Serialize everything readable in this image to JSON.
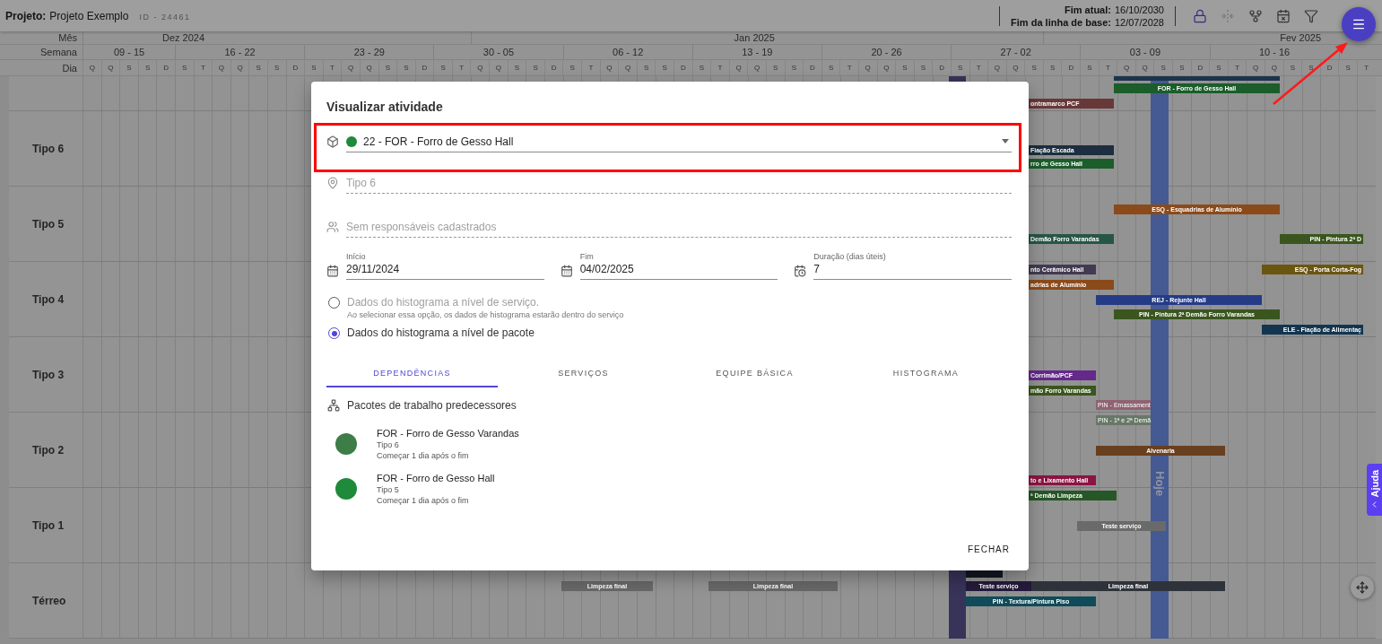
{
  "topbar": {
    "project_label": "Projeto:",
    "project_name": "Projeto Exemplo",
    "project_id": "ID - 24461",
    "current_end_label": "Fim atual:",
    "current_end": "16/10/2030",
    "baseline_end_label": "Fim da linha de base:",
    "baseline_end": "12/07/2028",
    "tools": [
      {
        "kind": "lock",
        "active": true,
        "disabled": false
      },
      {
        "kind": "split",
        "active": false,
        "disabled": true
      },
      {
        "kind": "branch",
        "active": false,
        "disabled": false
      },
      {
        "kind": "calendar-x",
        "active": false,
        "disabled": false
      },
      {
        "kind": "filter",
        "active": false,
        "disabled": false
      }
    ]
  },
  "timeline": {
    "month_label": "Mês",
    "week_label": "Semana",
    "day_label": "Dia",
    "months": [
      "Dez 2024",
      "Jan 2025",
      "Fev 2025"
    ],
    "weeks": [
      {
        "label": "09 - 15",
        "days": [
          "Q",
          "Q",
          "S",
          "S",
          "D"
        ]
      },
      {
        "label": "16 - 22",
        "days": [
          "S",
          "T",
          "Q",
          "Q",
          "S",
          "S",
          "D"
        ]
      },
      {
        "label": "23 - 29",
        "days": [
          "S",
          "T",
          "Q",
          "Q",
          "S",
          "S",
          "D"
        ]
      },
      {
        "label": "30 - 05",
        "days": [
          "S",
          "T",
          "Q",
          "Q",
          "S",
          "S",
          "D"
        ]
      },
      {
        "label": "06 - 12",
        "days": [
          "S",
          "T",
          "Q",
          "Q",
          "S",
          "S",
          "D"
        ]
      },
      {
        "label": "13 - 19",
        "days": [
          "S",
          "T",
          "Q",
          "Q",
          "S",
          "S",
          "D"
        ]
      },
      {
        "label": "20 - 26",
        "days": [
          "S",
          "T",
          "Q",
          "Q",
          "S",
          "S",
          "D"
        ]
      },
      {
        "label": "27 - 02",
        "days": [
          "S",
          "T",
          "Q",
          "Q",
          "S",
          "S",
          "D"
        ]
      },
      {
        "label": "03 - 09",
        "days": [
          "S",
          "T",
          "Q",
          "Q",
          "S",
          "S",
          "D"
        ]
      },
      {
        "label": "10 - 16",
        "days": [
          "S",
          "T",
          "Q",
          "Q",
          "S",
          "S",
          "D"
        ]
      },
      {
        "days": [
          "S",
          "T"
        ]
      }
    ],
    "today_label": "Hoje"
  },
  "rows": [
    "Tipo 6",
    "Tipo 5",
    "Tipo 4",
    "Tipo 3",
    "Tipo 2",
    "Tipo 1",
    "Térreo"
  ],
  "bars": [
    {
      "color": "#1c344a"
    },
    {
      "label": "FOR - Forro de Gesso Hall",
      "color": "#1b5d2b"
    },
    {
      "label": "ontramarco PCF",
      "color": "#683838"
    },
    {
      "label": "Fiação Escada",
      "color": "#1c2e3f"
    },
    {
      "label": "rro de Gesso Hall",
      "color": "#1b5d2b"
    },
    {
      "label": "ESQ - Esquadrias de Alumínio",
      "color": "#8b4a1a"
    },
    {
      "label": "Demão Forro Varandas",
      "color": "#275644"
    },
    {
      "label": "PIN - Pintura 2ª D",
      "color": "#3a561e"
    },
    {
      "label": "nto Cerâmico Hall",
      "color": "#423a52"
    },
    {
      "label": "ESQ - Porta Corta-Fog",
      "color": "#6b5610"
    },
    {
      "label": "adrias de Alumínio",
      "color": "#8b4a1a"
    },
    {
      "label": "REJ - Rejunte Hall",
      "color": "#253b86"
    },
    {
      "label": "PIN - Pintura 2ª Demão Forro Varandas",
      "color": "#3a561e"
    },
    {
      "label": "ELE - Fiação de Alimentaç",
      "color": "#13354f"
    },
    {
      "label": "Corrimão/PCF",
      "color": "#65288b"
    },
    {
      "label": "mão Forro Varandas",
      "color": "#3a561e"
    },
    {
      "label": "PIN - Emassament",
      "color": "#8f6372"
    },
    {
      "label": "PIN - 1ª e 2ª Demã",
      "color": "#687868"
    },
    {
      "label": "Alvenaria",
      "color": "#683f1f"
    },
    {
      "label": "to e Lixamento Hall",
      "color": "#8b1442"
    },
    {
      "label": "ª Demão Limpeza",
      "color": "#275627"
    },
    {
      "label": "Teste serviço",
      "color": "#6a6a6a"
    },
    {
      "label": "Limpeza final",
      "color": "#686868"
    },
    {
      "label": "Limpeza final",
      "color": "#686868"
    },
    {
      "color": "#111721"
    },
    {
      "label": "Teste serviço",
      "color": "#241a3b"
    },
    {
      "label": "Limpeza final",
      "color": "#2e333b"
    },
    {
      "label": "PIN - Textura/Pintura Piso",
      "color": "#104b59"
    }
  ],
  "modal": {
    "title": "Visualizar atividade",
    "activity": {
      "value": "22 - FOR - Forro de Gesso Hall",
      "color": "#1e8a3a"
    },
    "location": "Tipo 6",
    "responsibles": "Sem responsáveis cadastrados",
    "dates": [
      {
        "kind": "date",
        "label": "Início",
        "value": "29/11/2024"
      },
      {
        "kind": "date",
        "label": "Fim",
        "value": "04/02/2025"
      },
      {
        "kind": "duration",
        "label": "Duração (dias úteis)",
        "value": "7"
      }
    ],
    "histogram_options": [
      {
        "label": "Dados do histograma a nível de serviço.",
        "hint": "Ao selecionar essa opção, os dados de histograma estarão dentro do serviço",
        "selected": false,
        "disabled": true
      },
      {
        "label": "Dados do histograma a nível de pacote",
        "selected": true,
        "disabled": false
      }
    ],
    "tabs": [
      {
        "label": "DEPENDÊNCIAS",
        "selected": true
      },
      {
        "label": "SERVIÇOS",
        "selected": false
      },
      {
        "label": "EQUIPE BÁSICA",
        "selected": false
      },
      {
        "label": "HISTOGRAMA",
        "selected": false
      }
    ],
    "section_title": "Pacotes de trabalho predecessores",
    "predecessors": [
      {
        "name": "FOR - Forro de Gesso Varandas",
        "location": "Tipo 6",
        "rule": "Começar 1 dia após o fim",
        "color": "#3d7d47"
      },
      {
        "name": "FOR - Forro de Gesso Hall",
        "location": "Tipo 5",
        "rule": "Começar 1 dia após o fim",
        "color": "#1e8a3a"
      }
    ],
    "close_button": "FECHAR"
  },
  "help_tab": "Ajuda"
}
